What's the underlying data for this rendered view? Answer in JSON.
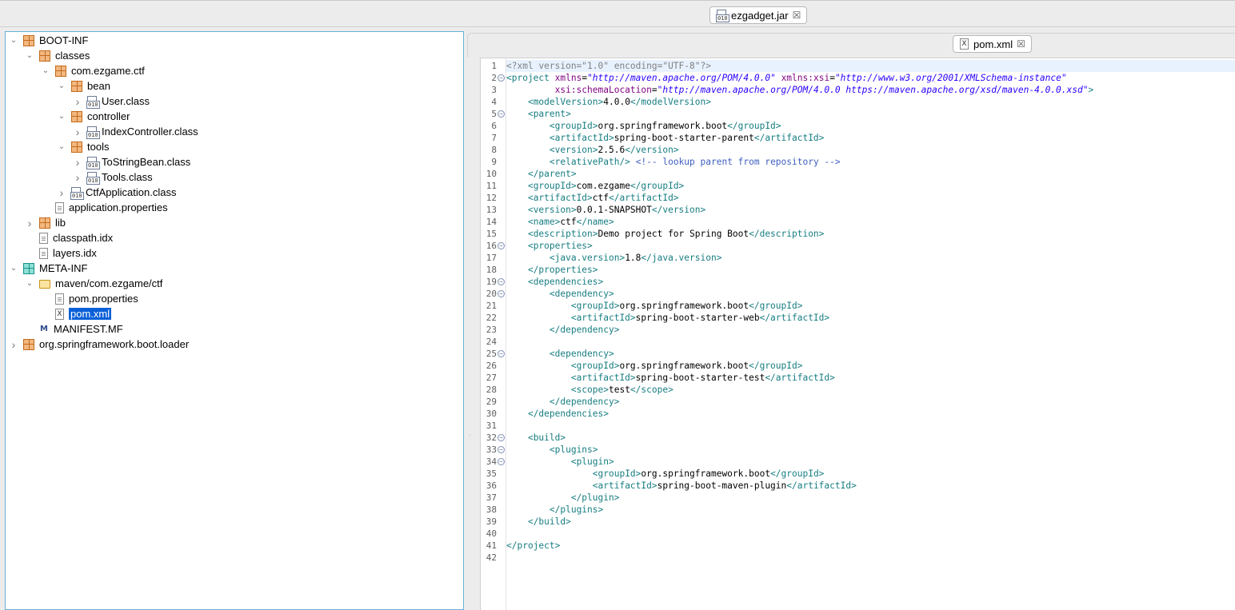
{
  "top_tab": {
    "label": "ezgadget.jar",
    "close": "☒"
  },
  "editor_tab": {
    "label": "pom.xml",
    "close": "☒"
  },
  "tree": [
    {
      "label": "BOOT-INF",
      "icon": "package-icon",
      "depth": 0,
      "twisty": "expanded"
    },
    {
      "label": "classes",
      "icon": "package-icon",
      "depth": 1,
      "twisty": "expanded"
    },
    {
      "label": "com.ezgame.ctf",
      "icon": "package-icon",
      "depth": 2,
      "twisty": "expanded"
    },
    {
      "label": "bean",
      "icon": "package-icon",
      "depth": 3,
      "twisty": "expanded"
    },
    {
      "label": "User.class",
      "icon": "class-file-icon",
      "depth": 4,
      "twisty": "collapsed"
    },
    {
      "label": "controller",
      "icon": "package-icon",
      "depth": 3,
      "twisty": "expanded"
    },
    {
      "label": "IndexController.class",
      "icon": "class-file-icon",
      "depth": 4,
      "twisty": "collapsed"
    },
    {
      "label": "tools",
      "icon": "package-icon",
      "depth": 3,
      "twisty": "expanded"
    },
    {
      "label": "ToStringBean.class",
      "icon": "class-file-icon",
      "depth": 4,
      "twisty": "collapsed"
    },
    {
      "label": "Tools.class",
      "icon": "class-file-icon",
      "depth": 4,
      "twisty": "collapsed"
    },
    {
      "label": "CtfApplication.class",
      "icon": "class-file-icon",
      "depth": 3,
      "twisty": "collapsed"
    },
    {
      "label": "application.properties",
      "icon": "text-file-icon",
      "depth": 2,
      "twisty": "none"
    },
    {
      "label": "lib",
      "icon": "package-icon",
      "depth": 1,
      "twisty": "collapsed"
    },
    {
      "label": "classpath.idx",
      "icon": "text-file-icon",
      "depth": 1,
      "twisty": "none"
    },
    {
      "label": "layers.idx",
      "icon": "text-file-icon",
      "depth": 1,
      "twisty": "none"
    },
    {
      "label": "META-INF",
      "icon": "package-teal-icon",
      "depth": 0,
      "twisty": "expanded"
    },
    {
      "label": "maven/com.ezgame/ctf",
      "icon": "folder-icon",
      "depth": 1,
      "twisty": "expanded"
    },
    {
      "label": "pom.properties",
      "icon": "text-file-icon",
      "depth": 2,
      "twisty": "none"
    },
    {
      "label": "pom.xml",
      "icon": "xml-file-icon",
      "depth": 2,
      "twisty": "none",
      "selected": true
    },
    {
      "label": "MANIFEST.MF",
      "icon": "manifest-icon",
      "depth": 1,
      "twisty": "none"
    },
    {
      "label": "org.springframework.boot.loader",
      "icon": "package-icon",
      "depth": 0,
      "twisty": "collapsed"
    }
  ],
  "code": {
    "folds": [
      2,
      5,
      16,
      19,
      20,
      25,
      32,
      33,
      34
    ],
    "lines": [
      [
        [
          "pi",
          "<?xml version=\"1.0\" encoding=\"UTF-8\"?>"
        ]
      ],
      [
        [
          "tag",
          "<project "
        ],
        [
          "attr",
          "xmlns"
        ],
        [
          "pl",
          "="
        ],
        [
          "val",
          "\"http://maven.apache.org/POM/4.0.0\""
        ],
        [
          "pl",
          " "
        ],
        [
          "attr",
          "xmlns:xsi"
        ],
        [
          "pl",
          "="
        ],
        [
          "val",
          "\"http://www.w3.org/2001/XMLSchema-instance\""
        ]
      ],
      [
        [
          "pl",
          "         "
        ],
        [
          "attr",
          "xsi:schemaLocation"
        ],
        [
          "pl",
          "="
        ],
        [
          "val",
          "\"http://maven.apache.org/POM/4.0.0 https://maven.apache.org/xsd/maven-4.0.0.xsd\""
        ],
        [
          "tag",
          ">"
        ]
      ],
      [
        [
          "pl",
          "    "
        ],
        [
          "tag",
          "<modelVersion>"
        ],
        [
          "txt",
          "4.0.0"
        ],
        [
          "tag",
          "</modelVersion>"
        ]
      ],
      [
        [
          "pl",
          "    "
        ],
        [
          "tag",
          "<parent>"
        ]
      ],
      [
        [
          "pl",
          "        "
        ],
        [
          "tag",
          "<groupId>"
        ],
        [
          "txt",
          "org.springframework.boot"
        ],
        [
          "tag",
          "</groupId>"
        ]
      ],
      [
        [
          "pl",
          "        "
        ],
        [
          "tag",
          "<artifactId>"
        ],
        [
          "txt",
          "spring-boot-starter-parent"
        ],
        [
          "tag",
          "</artifactId>"
        ]
      ],
      [
        [
          "pl",
          "        "
        ],
        [
          "tag",
          "<version>"
        ],
        [
          "txt",
          "2.5.6"
        ],
        [
          "tag",
          "</version>"
        ]
      ],
      [
        [
          "pl",
          "        "
        ],
        [
          "tag",
          "<relativePath/>"
        ],
        [
          "pl",
          " "
        ],
        [
          "com",
          "<!-- lookup parent from repository -->"
        ]
      ],
      [
        [
          "pl",
          "    "
        ],
        [
          "tag",
          "</parent>"
        ]
      ],
      [
        [
          "pl",
          "    "
        ],
        [
          "tag",
          "<groupId>"
        ],
        [
          "txt",
          "com.ezgame"
        ],
        [
          "tag",
          "</groupId>"
        ]
      ],
      [
        [
          "pl",
          "    "
        ],
        [
          "tag",
          "<artifactId>"
        ],
        [
          "txt",
          "ctf"
        ],
        [
          "tag",
          "</artifactId>"
        ]
      ],
      [
        [
          "pl",
          "    "
        ],
        [
          "tag",
          "<version>"
        ],
        [
          "txt",
          "0.0.1-SNAPSHOT"
        ],
        [
          "tag",
          "</version>"
        ]
      ],
      [
        [
          "pl",
          "    "
        ],
        [
          "tag",
          "<name>"
        ],
        [
          "txt",
          "ctf"
        ],
        [
          "tag",
          "</name>"
        ]
      ],
      [
        [
          "pl",
          "    "
        ],
        [
          "tag",
          "<description>"
        ],
        [
          "txt",
          "Demo project for Spring Boot"
        ],
        [
          "tag",
          "</description>"
        ]
      ],
      [
        [
          "pl",
          "    "
        ],
        [
          "tag",
          "<properties>"
        ]
      ],
      [
        [
          "pl",
          "        "
        ],
        [
          "tag",
          "<java.version>"
        ],
        [
          "txt",
          "1.8"
        ],
        [
          "tag",
          "</java.version>"
        ]
      ],
      [
        [
          "pl",
          "    "
        ],
        [
          "tag",
          "</properties>"
        ]
      ],
      [
        [
          "pl",
          "    "
        ],
        [
          "tag",
          "<dependencies>"
        ]
      ],
      [
        [
          "pl",
          "        "
        ],
        [
          "tag",
          "<dependency>"
        ]
      ],
      [
        [
          "pl",
          "            "
        ],
        [
          "tag",
          "<groupId>"
        ],
        [
          "txt",
          "org.springframework.boot"
        ],
        [
          "tag",
          "</groupId>"
        ]
      ],
      [
        [
          "pl",
          "            "
        ],
        [
          "tag",
          "<artifactId>"
        ],
        [
          "txt",
          "spring-boot-starter-web"
        ],
        [
          "tag",
          "</artifactId>"
        ]
      ],
      [
        [
          "pl",
          "        "
        ],
        [
          "tag",
          "</dependency>"
        ]
      ],
      [],
      [
        [
          "pl",
          "        "
        ],
        [
          "tag",
          "<dependency>"
        ]
      ],
      [
        [
          "pl",
          "            "
        ],
        [
          "tag",
          "<groupId>"
        ],
        [
          "txt",
          "org.springframework.boot"
        ],
        [
          "tag",
          "</groupId>"
        ]
      ],
      [
        [
          "pl",
          "            "
        ],
        [
          "tag",
          "<artifactId>"
        ],
        [
          "txt",
          "spring-boot-starter-test"
        ],
        [
          "tag",
          "</artifactId>"
        ]
      ],
      [
        [
          "pl",
          "            "
        ],
        [
          "tag",
          "<scope>"
        ],
        [
          "txt",
          "test"
        ],
        [
          "tag",
          "</scope>"
        ]
      ],
      [
        [
          "pl",
          "        "
        ],
        [
          "tag",
          "</dependency>"
        ]
      ],
      [
        [
          "pl",
          "    "
        ],
        [
          "tag",
          "</dependencies>"
        ]
      ],
      [],
      [
        [
          "pl",
          "    "
        ],
        [
          "tag",
          "<build>"
        ]
      ],
      [
        [
          "pl",
          "        "
        ],
        [
          "tag",
          "<plugins>"
        ]
      ],
      [
        [
          "pl",
          "            "
        ],
        [
          "tag",
          "<plugin>"
        ]
      ],
      [
        [
          "pl",
          "                "
        ],
        [
          "tag",
          "<groupId>"
        ],
        [
          "txt",
          "org.springframework.boot"
        ],
        [
          "tag",
          "</groupId>"
        ]
      ],
      [
        [
          "pl",
          "                "
        ],
        [
          "tag",
          "<artifactId>"
        ],
        [
          "txt",
          "spring-boot-maven-plugin"
        ],
        [
          "tag",
          "</artifactId>"
        ]
      ],
      [
        [
          "pl",
          "            "
        ],
        [
          "tag",
          "</plugin>"
        ]
      ],
      [
        [
          "pl",
          "        "
        ],
        [
          "tag",
          "</plugins>"
        ]
      ],
      [
        [
          "pl",
          "    "
        ],
        [
          "tag",
          "</build>"
        ]
      ],
      [],
      [
        [
          "tag",
          "</project>"
        ]
      ],
      []
    ]
  }
}
